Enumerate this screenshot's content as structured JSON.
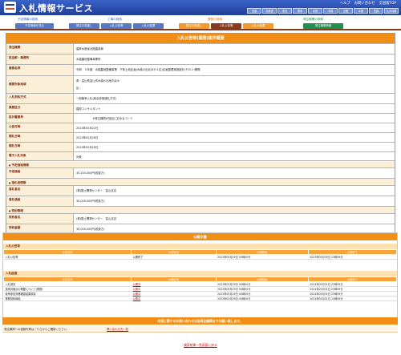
{
  "header": {
    "title": "入札情報サービス",
    "links": [
      "ヘルプ",
      "お問い合わせ",
      "全国版TOP"
    ],
    "regions": [
      "全国",
      "北海道",
      "東北",
      "関東",
      "北陸",
      "中部",
      "近畿",
      "中国",
      "四国",
      "九州沖縄"
    ]
  },
  "nav": {
    "groups": [
      "予定情報の検索",
      "工事の検索",
      "業務の検索",
      "発注機関の検索"
    ],
    "buttons": [
      "予定情報を見る",
      "発注の見通し",
      "入札公告等",
      "入札の結果",
      "発注の見通し",
      "入札公告等",
      "入札の結果",
      "発注機関情報"
    ]
  },
  "detail": {
    "title": "入札公告等(業務)案件概要",
    "rows": {
      "agency": {
        "label": "発注機関",
        "value": "農林水産省北陸農政局"
      },
      "office": {
        "label": "担当部・事務所",
        "value": "水橋農地整備事業所"
      },
      "project": {
        "label": "業務名称",
        "value": "令和　５年度　水橋農地整備事業　下条土地区画(水橋小出北ほか２区)区画整理実施設計(その２)業務"
      },
      "location": {
        "label": "業務対象地域",
        "value": [
          "県：富山県富山市水橋小出地内ほか",
          "区："
        ]
      },
      "method": {
        "label": "入札契約方式",
        "value": "一般競争入札(総合評価落札方式)"
      },
      "category": {
        "label": "業務区分",
        "value": "建設コンサルタント"
      },
      "number": {
        "label": "設計書番号",
        "value": "　　　　　　※発注機関が独自に定めるコード"
      },
      "pub_date": {
        "label": "公告日時",
        "value": "2023年05月22日"
      },
      "sub_date": {
        "label": "開札日時",
        "value": "2023年05月16日"
      },
      "open_date": {
        "label": "開札日時",
        "value": "2023年05月16日"
      },
      "e_bid": {
        "label": "電子入札対象",
        "value": "対象"
      }
    },
    "section_estimate": "予定価格情報",
    "estimate": {
      "label": "予定価格",
      "value": "35,200,000円(税抜き)"
    },
    "section_winner": "落札者情報",
    "winner_name": {
      "label": "落札者名",
      "value": "(株)国土開発センター　富山支店"
    },
    "winner_price": {
      "label": "落札価格",
      "value": "30,000,000円(税抜き)"
    },
    "section_contract": "契約情報",
    "contractor": {
      "label": "契約者名",
      "value": "(株)国土開発センター　富山支店"
    },
    "contract_price": {
      "label": "契約金額",
      "value": "30,000,000円(税抜き)"
    }
  },
  "docs": {
    "title": "公開文書",
    "columns": [
      "文書名称",
      "公開状況",
      "公開開始",
      "公開終了"
    ],
    "sec1_head": "入札公告等",
    "sec1_rows": [
      [
        "入札公告等",
        "公開終了",
        "2023年05月29日 00時00分",
        "2023年05月30日 23時59分"
      ]
    ],
    "sec2_head": "入札経過",
    "sec2_rows": [
      [
        "入札調書",
        "公開中",
        "2023年05月29日 00時00分",
        "2024年05月31日 23時59分"
      ],
      [
        "技術評価点の概要について(業務)",
        "公開中",
        "2023年05月29日 00時00分",
        "2024年05月31日 23時59分"
      ],
      [
        "競争参加資格確認結果調書",
        "公開中",
        "2023年05月29日 00時00分",
        "2024年05月31日 23時59分"
      ],
      [
        "業務契約締結",
        "公開中",
        "2023年05月29日 00時00分",
        "2024年05月31日 23時59分"
      ]
    ]
  },
  "inquiry": {
    "bar": "内容に関するお問い合わせは各発注機関までお願い致します。",
    "text": "発注機関への連絡先等はこちらからご確認ください。",
    "link": "問い合わせ先一覧"
  },
  "footer": {
    "back_link": "検索結果一覧画面に戻る"
  }
}
